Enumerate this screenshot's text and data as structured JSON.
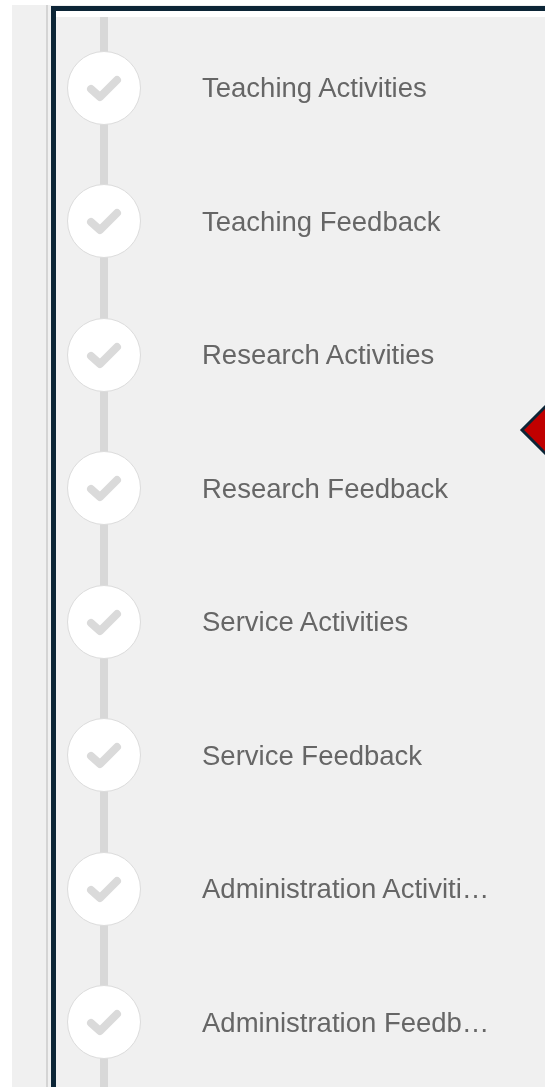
{
  "steps": [
    {
      "label": "Teaching Activities"
    },
    {
      "label": "Teaching Feedback"
    },
    {
      "label": "Research Activities"
    },
    {
      "label": "Research Feedback"
    },
    {
      "label": "Service Activities"
    },
    {
      "label": "Service Feedback"
    },
    {
      "label": "Administration Activiti…"
    },
    {
      "label": "Administration Feedb…"
    }
  ]
}
